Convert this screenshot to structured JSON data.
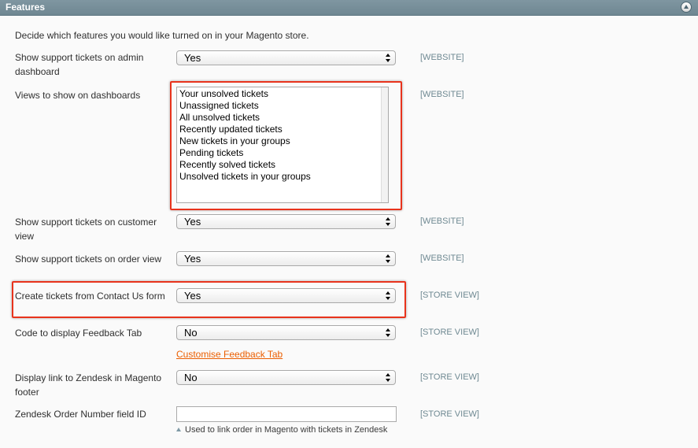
{
  "section": {
    "title": "Features"
  },
  "intro": "Decide which features you would like turned on in your Magento store.",
  "fields": [
    {
      "label": "Show support tickets on admin dashboard",
      "value": "Yes",
      "scope": "[WEBSITE]"
    },
    {
      "label": "Views to show on dashboards",
      "scope": "[WEBSITE]",
      "options": [
        "Your unsolved tickets",
        "Unassigned tickets",
        "All unsolved tickets",
        "Recently updated tickets",
        "New tickets in your groups",
        "Pending tickets",
        "Recently solved tickets",
        "Unsolved tickets in your groups"
      ]
    },
    {
      "label": "Show support tickets on customer view",
      "value": "Yes",
      "scope": "[WEBSITE]"
    },
    {
      "label": "Show support tickets on order view",
      "value": "Yes",
      "scope": "[WEBSITE]"
    },
    {
      "label": "Create tickets from Contact Us form",
      "value": "Yes",
      "scope": "[STORE VIEW]"
    },
    {
      "label": "Code to display Feedback Tab",
      "value": "No",
      "scope": "[STORE VIEW]",
      "link": "Customise Feedback Tab"
    },
    {
      "label": "Display link to Zendesk in Magento footer",
      "value": "No",
      "scope": "[STORE VIEW]"
    },
    {
      "label": "Zendesk Order Number field ID",
      "value": "",
      "scope": "[STORE VIEW]",
      "note": "Used to link order in Magento with tickets in Zendesk"
    }
  ],
  "icons": {
    "collapse": "collapse-up-icon",
    "select_arrows": "select-arrows-icon",
    "note": "note-triangle-icon"
  },
  "colors": {
    "header": "#6f8792",
    "highlight": "#e8331c",
    "link": "#eb5e00",
    "scope": "#6f8992"
  }
}
